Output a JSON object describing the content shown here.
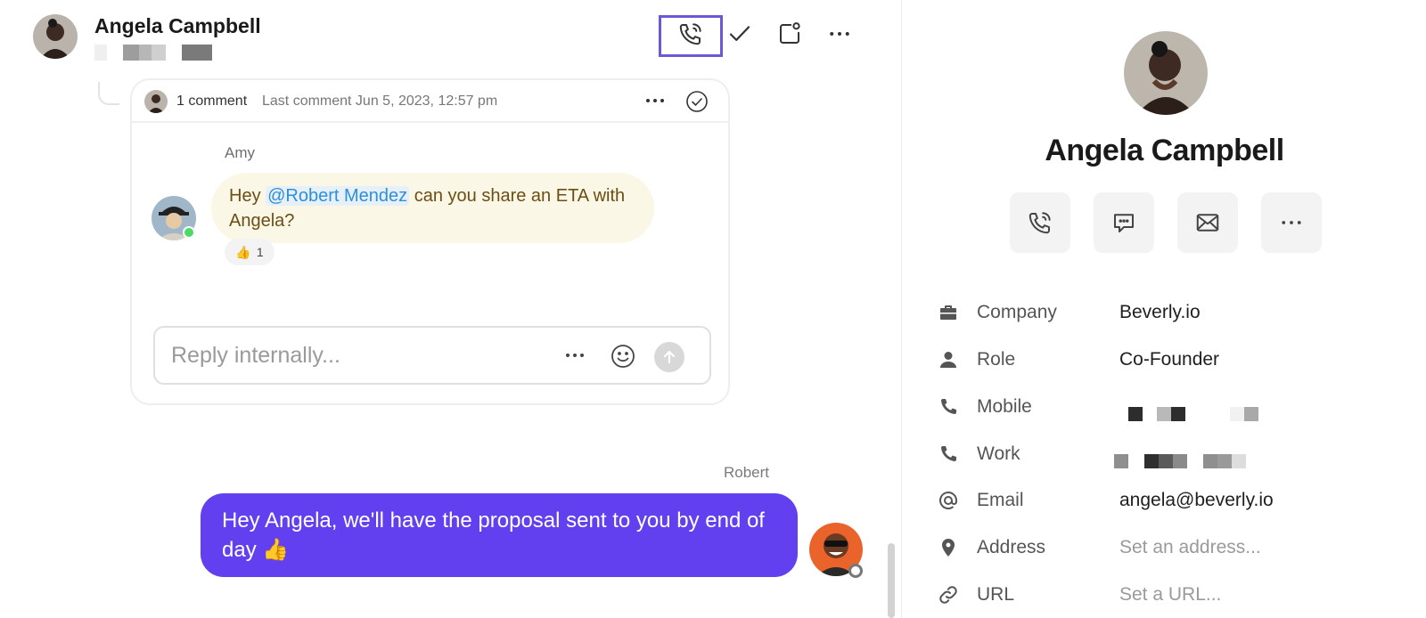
{
  "header": {
    "contact_name": "Angela Campbell"
  },
  "thread": {
    "comment_count": "1 comment",
    "last_comment": "Last comment Jun 5, 2023, 12:57 pm",
    "author": "Amy",
    "message_prefix": "Hey ",
    "mention": "@Robert Mendez",
    "message_suffix": " can you share an ETA with Angela?",
    "reaction_emoji": "👍",
    "reaction_count": "1",
    "reply_placeholder": "Reply internally..."
  },
  "outgoing": {
    "author": "Robert",
    "message": "Hey Angela, we'll have the proposal sent to you by end of day 👍"
  },
  "profile": {
    "name": "Angela Campbell",
    "fields": [
      {
        "label": "Company",
        "value": "Beverly.io"
      },
      {
        "label": "Role",
        "value": "Co-Founder"
      },
      {
        "label": "Mobile",
        "value": ""
      },
      {
        "label": "Work",
        "value": ""
      },
      {
        "label": "Email",
        "value": "angela@beverly.io"
      },
      {
        "label": "Address",
        "value": "Set an address..."
      },
      {
        "label": "URL",
        "value": "Set a URL..."
      }
    ]
  },
  "colors": {
    "brand_purple": "#6240f0",
    "highlight_border": "#6a58d6",
    "mention_blue": "#2f8fd9",
    "note_bubble": "#fbf7e6"
  },
  "icons": [
    "phone-call-icon",
    "check-icon",
    "snooze-icon",
    "more-icon",
    "resolve-icon",
    "emoji-icon",
    "send-icon",
    "chat-icon",
    "mail-icon",
    "briefcase-icon",
    "person-icon",
    "phone-icon",
    "at-icon",
    "pin-icon",
    "link-icon"
  ]
}
